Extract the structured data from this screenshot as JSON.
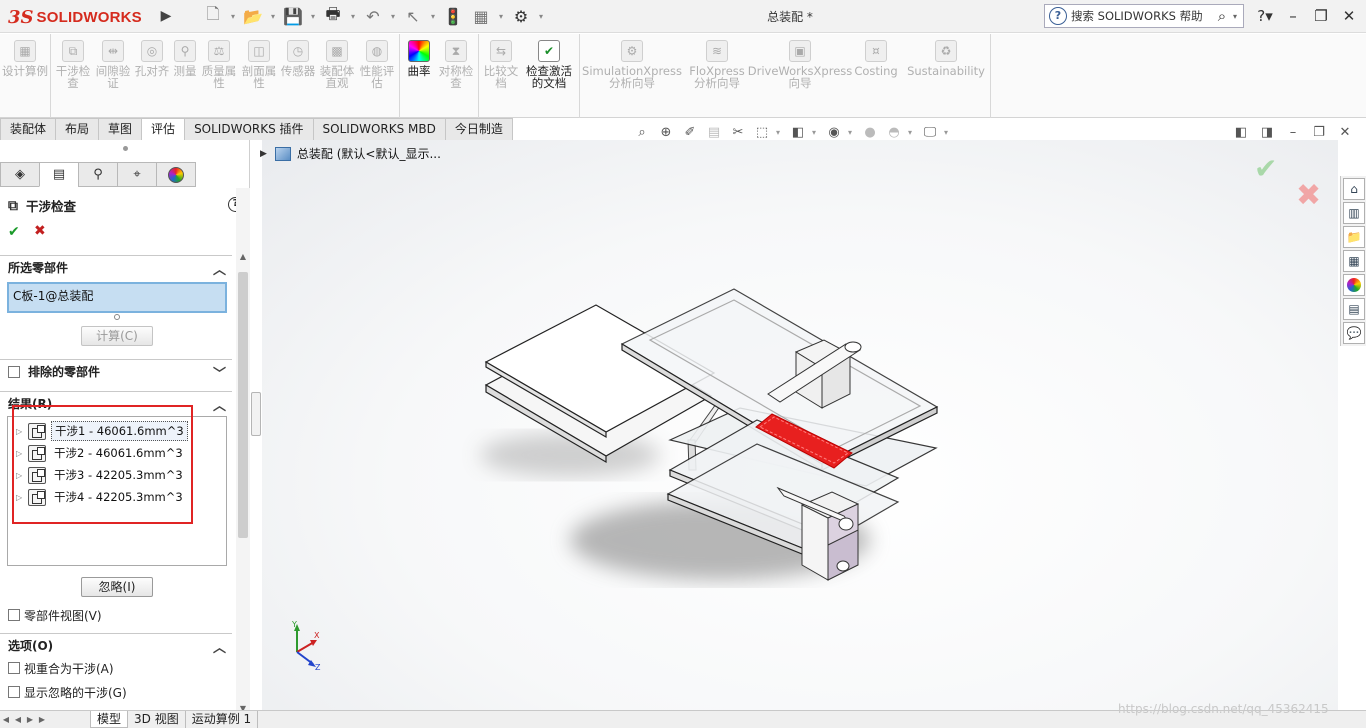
{
  "app": {
    "logo_ds": "3S",
    "logo_text": "SOLIDWORKS",
    "doc_title": "总装配 *",
    "help_search": "搜索 SOLIDWORKS 帮助"
  },
  "quick_access": [
    "new-icon",
    "open-icon",
    "save-icon",
    "print-icon",
    "undo-icon",
    "select-icon",
    "rebuild-icon",
    "file-properties-icon",
    "options-icon"
  ],
  "ribbon": {
    "groups": [
      [
        {
          "label": "设计算例",
          "icon": "design-study-icon",
          "active": false
        }
      ],
      [
        {
          "label": "干涉检查",
          "icon": "interference-icon",
          "active": false
        },
        {
          "label": "间隙验证",
          "icon": "clearance-icon",
          "active": false
        },
        {
          "label": "孔对齐",
          "icon": "hole-align-icon",
          "active": false
        },
        {
          "label": "测量",
          "icon": "measure-icon",
          "active": false
        },
        {
          "label": "质量属性",
          "icon": "mass-props-icon",
          "active": false
        },
        {
          "label": "剖面属性",
          "icon": "section-props-icon",
          "active": false
        },
        {
          "label": "传感器",
          "icon": "sensor-icon",
          "active": false
        },
        {
          "label": "装配体直观",
          "icon": "assembly-viz-icon",
          "active": false
        },
        {
          "label": "性能评估",
          "icon": "performance-icon",
          "active": false
        }
      ],
      [
        {
          "label": "曲率",
          "icon": "curvature-icon",
          "active": true
        },
        {
          "label": "对称检查",
          "icon": "symmetry-icon",
          "active": false
        }
      ],
      [
        {
          "label": "比较文档",
          "icon": "compare-icon",
          "active": false
        },
        {
          "label": "检查激活的文档",
          "icon": "check-doc-icon",
          "active": true
        }
      ],
      [
        {
          "label": "SimulationXpress 分析向导",
          "icon": "simxpress-icon",
          "active": false
        },
        {
          "label": "FloXpress 分析向导",
          "icon": "floxpress-icon",
          "active": false
        },
        {
          "label": "DriveWorksXpress 向导",
          "icon": "driveworks-icon",
          "active": false
        },
        {
          "label": "Costing",
          "icon": "costing-icon",
          "active": false
        },
        {
          "label": "Sustainability",
          "icon": "sustainability-icon",
          "active": false
        }
      ]
    ]
  },
  "tabs": [
    {
      "label": "装配体",
      "active": false
    },
    {
      "label": "布局",
      "active": false
    },
    {
      "label": "草图",
      "active": false
    },
    {
      "label": "评估",
      "active": true
    },
    {
      "label": "SOLIDWORKS 插件",
      "active": false
    },
    {
      "label": "SOLIDWORKS MBD",
      "active": false
    },
    {
      "label": "今日制造",
      "active": false
    }
  ],
  "property_manager": {
    "title": "干涉检查",
    "help": "?",
    "selected_section": "所选零部件",
    "selected_value": "C板-1@总装配",
    "calculate_btn": "计算(C)",
    "excluded_section": "排除的零部件",
    "results_section": "结果(R)",
    "results": [
      "干涉1 - 46061.6mm^3",
      "干涉2 - 46061.6mm^3",
      "干涉3 - 42205.3mm^3",
      "干涉4 - 42205.3mm^3"
    ],
    "ignore_btn": "忽略(I)",
    "component_view": "零部件视图(V)",
    "options_section": "选项(O)",
    "opt1": "视重合为干涉(A)",
    "opt2": "显示忽略的干涉(G)"
  },
  "graphics": {
    "tree_root": "总装配 (默认<默认_显示..."
  },
  "bottom_tabs": [
    {
      "label": "模型",
      "active": true
    },
    {
      "label": "3D 视图",
      "active": false
    },
    {
      "label": "运动算例 1",
      "active": false
    }
  ],
  "watermark": "https://blog.csdn.net/qq_45362415"
}
